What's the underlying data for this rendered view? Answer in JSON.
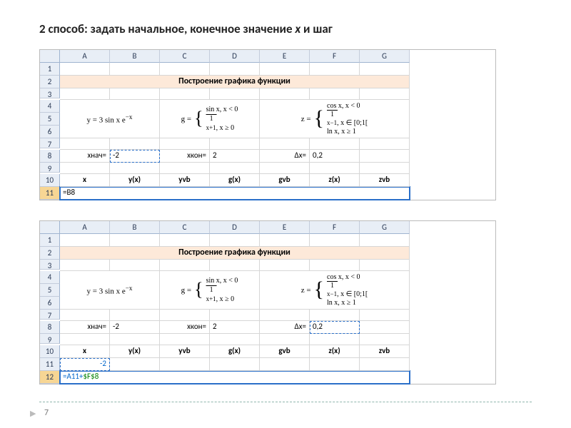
{
  "title_prefix": "2 способ: задать начальное, конечное значение ",
  "title_var": "x",
  "title_suffix": " и шаг",
  "cols": [
    "A",
    "B",
    "C",
    "D",
    "E",
    "F",
    "G"
  ],
  "heading": "Построение графика функции",
  "eq_y": "y = 3 sin x e^{-x}",
  "eq_g_top": "sin x, x < 0",
  "eq_g_bot": "1/(x+1), x ≥ 0",
  "eq_g_name": "g =",
  "eq_z_name": "z =",
  "eq_z_1": "cos x, x < 0",
  "eq_z_2": "1/(x−1), x ∈ [0;1[",
  "eq_z_3": "ln x, x ≥ 1",
  "labels": {
    "xstart": "хнач=",
    "xend": "xкон=",
    "dx": "Δx=",
    "xstart_val": "-2",
    "xend_val": "2",
    "dx_val": "0,2"
  },
  "col_labels": [
    "x",
    "y(x)",
    "yvb",
    "g(x)",
    "gvb",
    "z(x)",
    "zvb"
  ],
  "sheet1": {
    "rows": [
      "1",
      "2",
      "3",
      "4",
      "5",
      "6",
      "7",
      "8",
      "9",
      "10",
      "11"
    ],
    "formula": "=B8"
  },
  "sheet2": {
    "rows": [
      "1",
      "2",
      "3",
      "4",
      "5",
      "6",
      "7",
      "8",
      "9",
      "10",
      "11",
      "12"
    ],
    "a11_val": "-2",
    "formula_a": "=A11+",
    "formula_b": "$F$8"
  },
  "page": "7"
}
